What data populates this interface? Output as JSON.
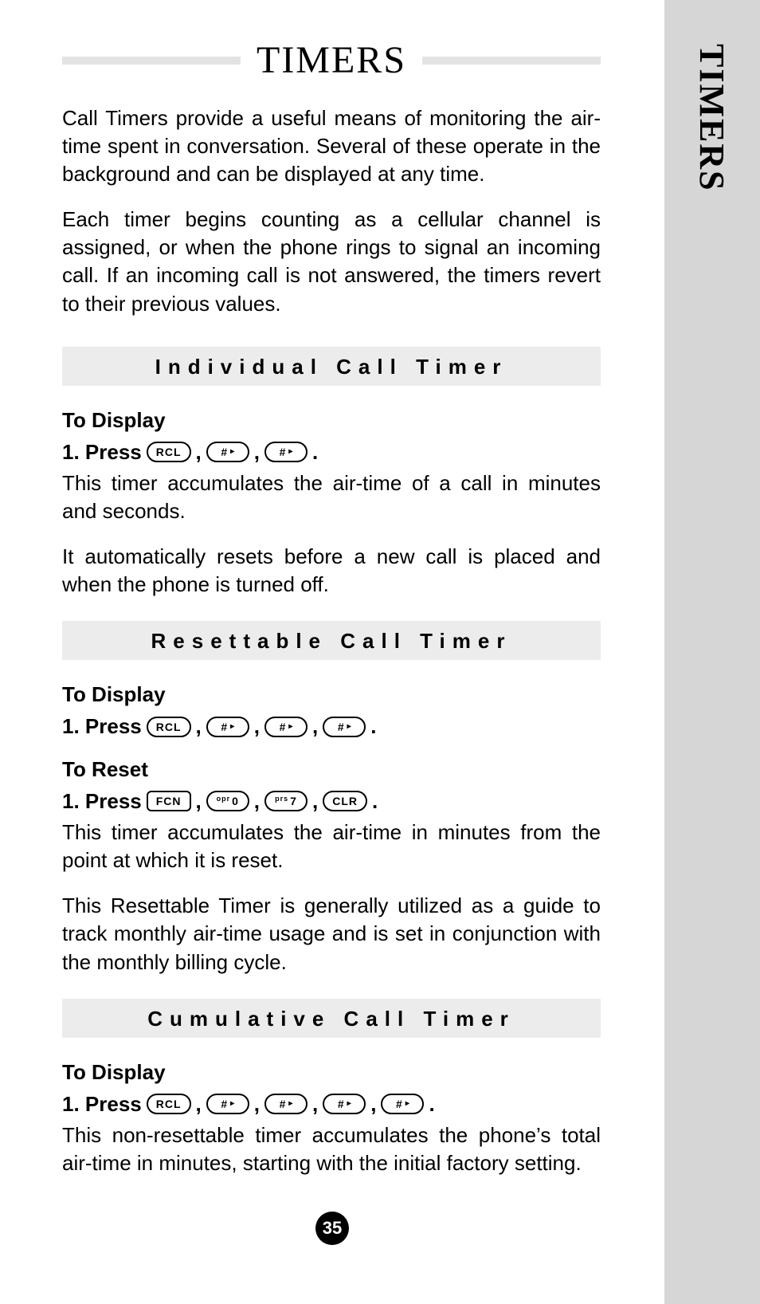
{
  "side_tab": "TIMERS",
  "title": "TIMERS",
  "intro1": "Call Timers provide a useful means of monitoring the air-time spent in conversation. Several of these operate in the background and can be displayed at any time.",
  "intro2": "Each timer begins counting as a cellular channel is assigned, or when the phone rings to signal an incoming call. If an incoming call is not answered, the timers revert to their previous values.",
  "keys": {
    "rcl": "RCL",
    "hash": "#",
    "hash_tri": "▸",
    "fcn": "FCN",
    "zero_sup": "opr",
    "zero": "0",
    "seven_sup": "prs",
    "seven": "7",
    "clr": "CLR"
  },
  "sec_individual": {
    "heading": "Individual Call Timer",
    "to_display": "To Display",
    "step_prefix": "1. Press",
    "desc1": "This timer accumulates the air-time of a call in minutes and seconds.",
    "desc2": "It automatically resets before a new call is placed and when the phone is turned off."
  },
  "sec_resettable": {
    "heading": "Resettable Call Timer",
    "to_display": "To Display",
    "to_reset": "To Reset",
    "step_prefix": "1. Press",
    "desc1": "This timer accumulates the air-time in minutes from the point at which it is reset.",
    "desc2": "This Resettable Timer is generally utilized as a guide to track monthly air-time usage and is set in conjunction with the monthly billing cycle."
  },
  "sec_cumulative": {
    "heading": "Cumulative Call Timer",
    "to_display": "To Display",
    "step_prefix": "1. Press",
    "desc": "This non-resettable timer accumulates the phone’s total air-time in minutes, starting with the initial factory setting."
  },
  "page_number": "35",
  "sep": ","
}
